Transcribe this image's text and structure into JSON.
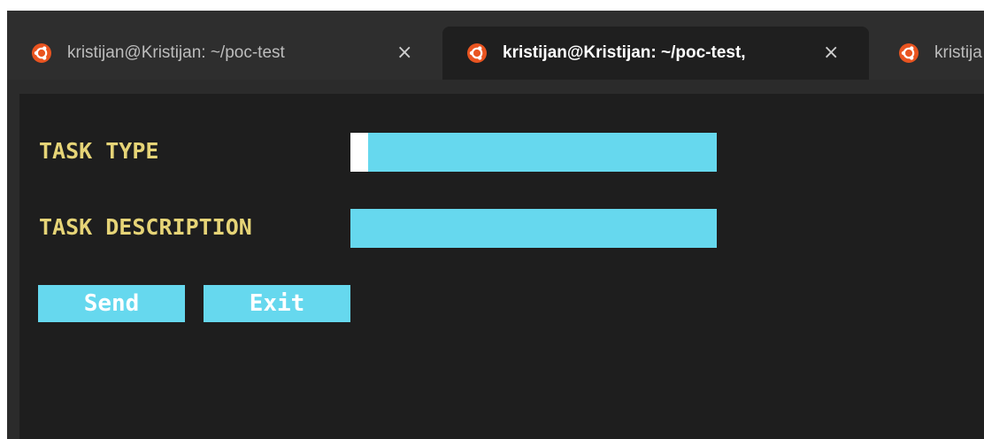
{
  "tabs": [
    {
      "title": "kristijan@Kristijan: ~/poc-test",
      "close": "×",
      "icon": "ubuntu-icon"
    },
    {
      "title": "kristijan@Kristijan: ~/poc-test,",
      "close": "×",
      "icon": "ubuntu-icon",
      "active": true
    },
    {
      "title": "kristija",
      "icon": "ubuntu-icon"
    }
  ],
  "form": {
    "task_type_label": "TASK TYPE",
    "task_type_value": "",
    "task_description_label": "TASK DESCRIPTION",
    "task_description_value": "",
    "send_label": "Send",
    "exit_label": "Exit"
  },
  "colors": {
    "label": "#e6d477",
    "field": "#66d8ee",
    "terminal_bg": "#1e1e1e",
    "ubuntu_orange": "#e95420"
  }
}
